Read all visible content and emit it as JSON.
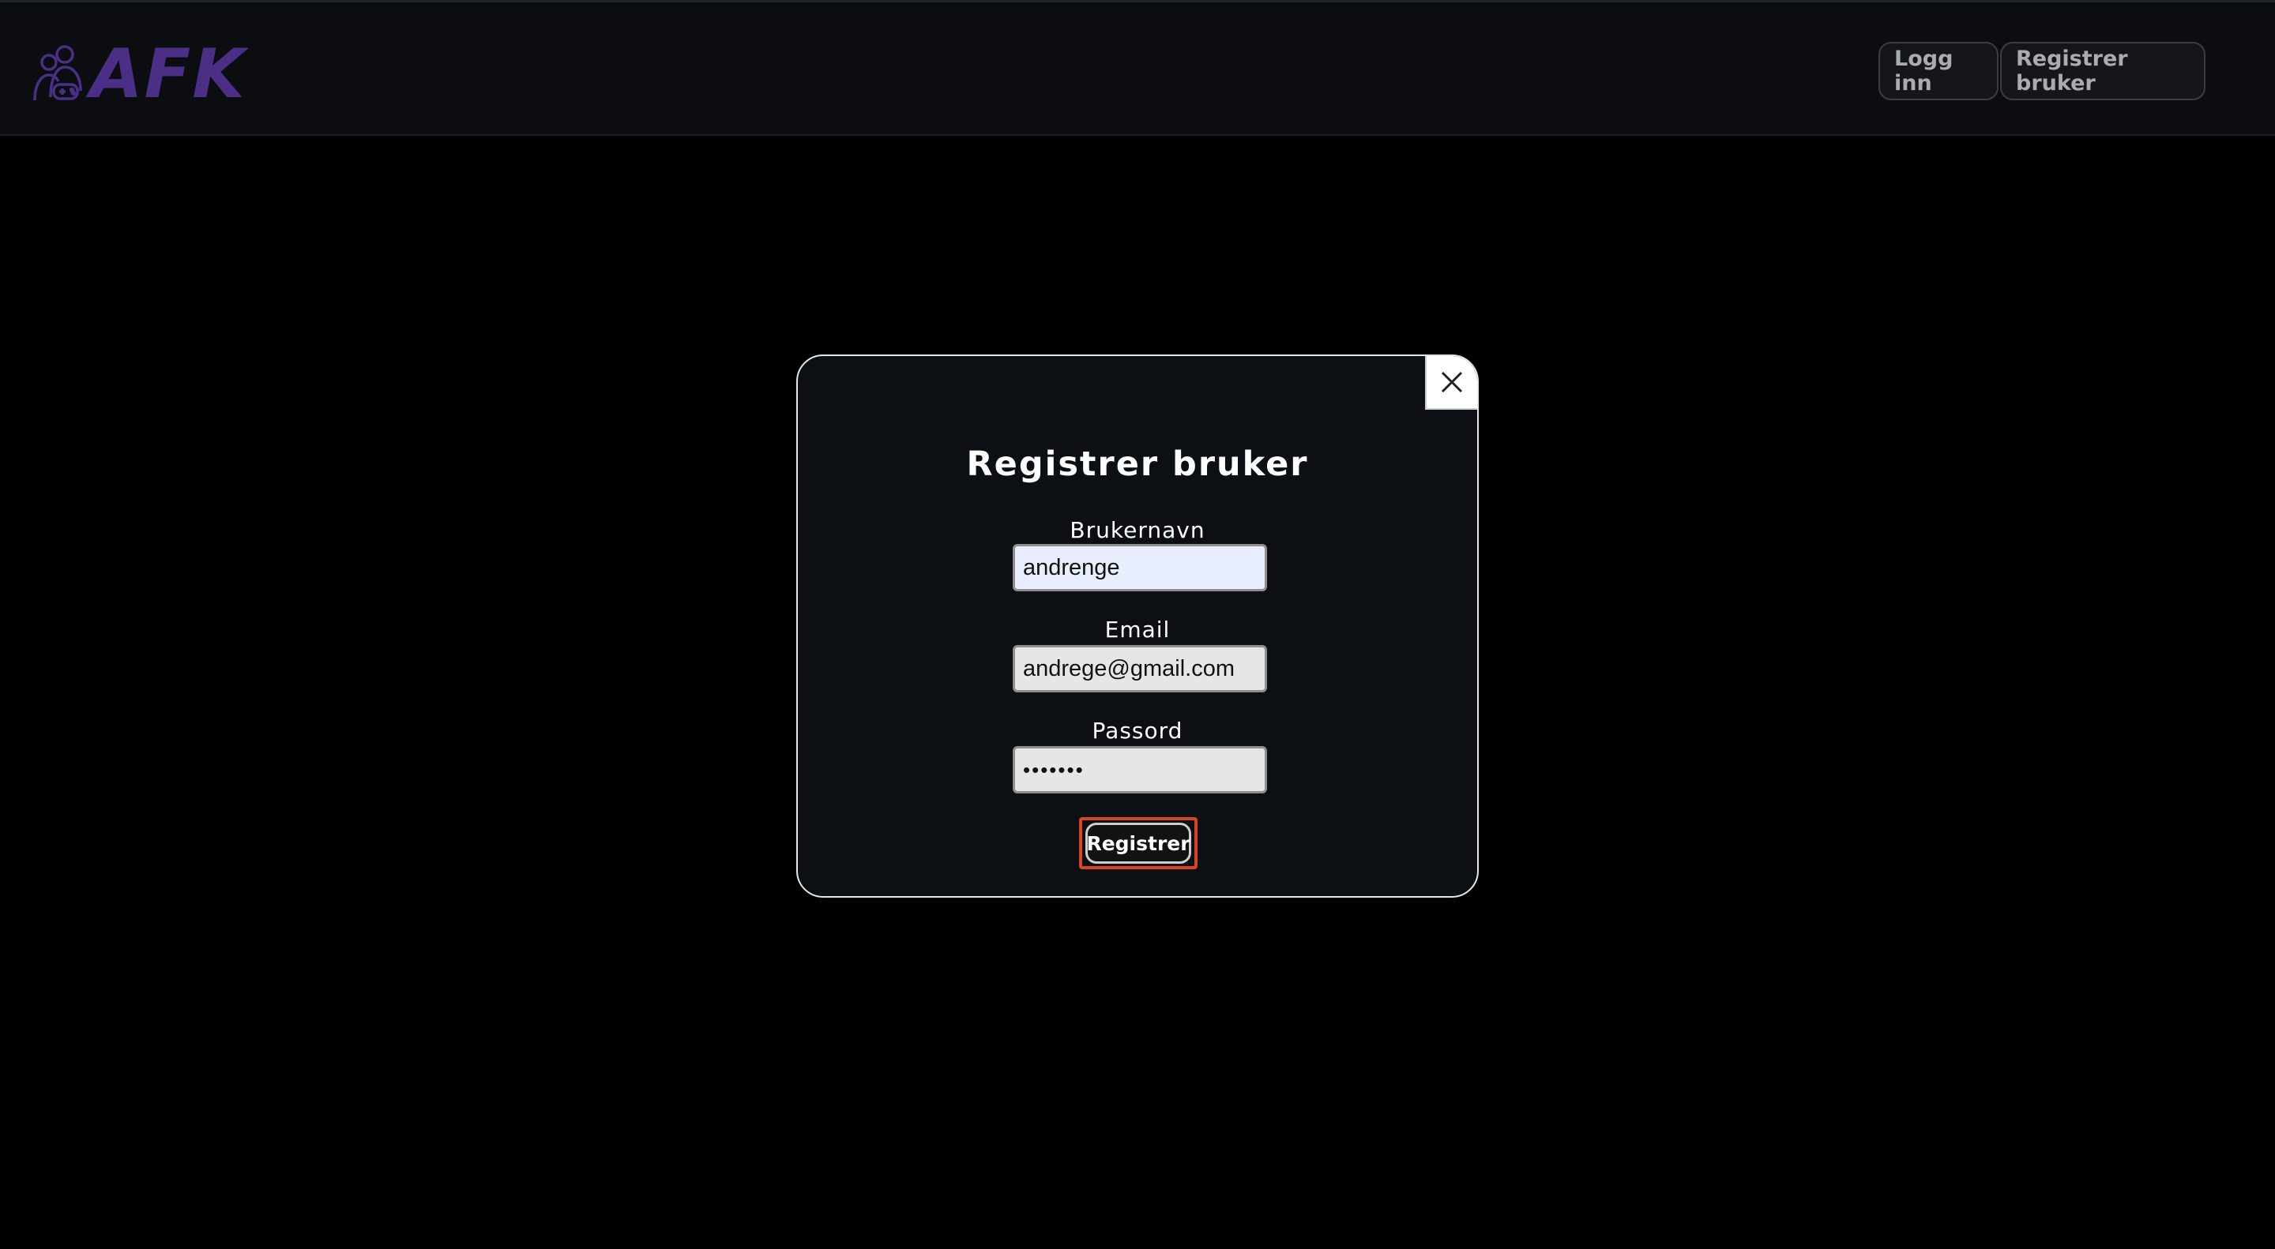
{
  "header": {
    "logo_text": "AFK",
    "login_label": "Logg inn",
    "register_label": "Registrer bruker"
  },
  "modal": {
    "title": "Registrer bruker",
    "fields": [
      {
        "label": "Brukernavn",
        "value": "andrenge"
      },
      {
        "label": "Email",
        "value": "andrege@gmail.com"
      },
      {
        "label": "Passord",
        "value": "•••••••"
      }
    ],
    "submit_label": "Registrer",
    "close_icon": "close-icon"
  },
  "colors": {
    "brand": "#4b2f86",
    "focus_outline": "#d8451f",
    "page_background": "#000000",
    "modal_background": "#0c1014"
  }
}
